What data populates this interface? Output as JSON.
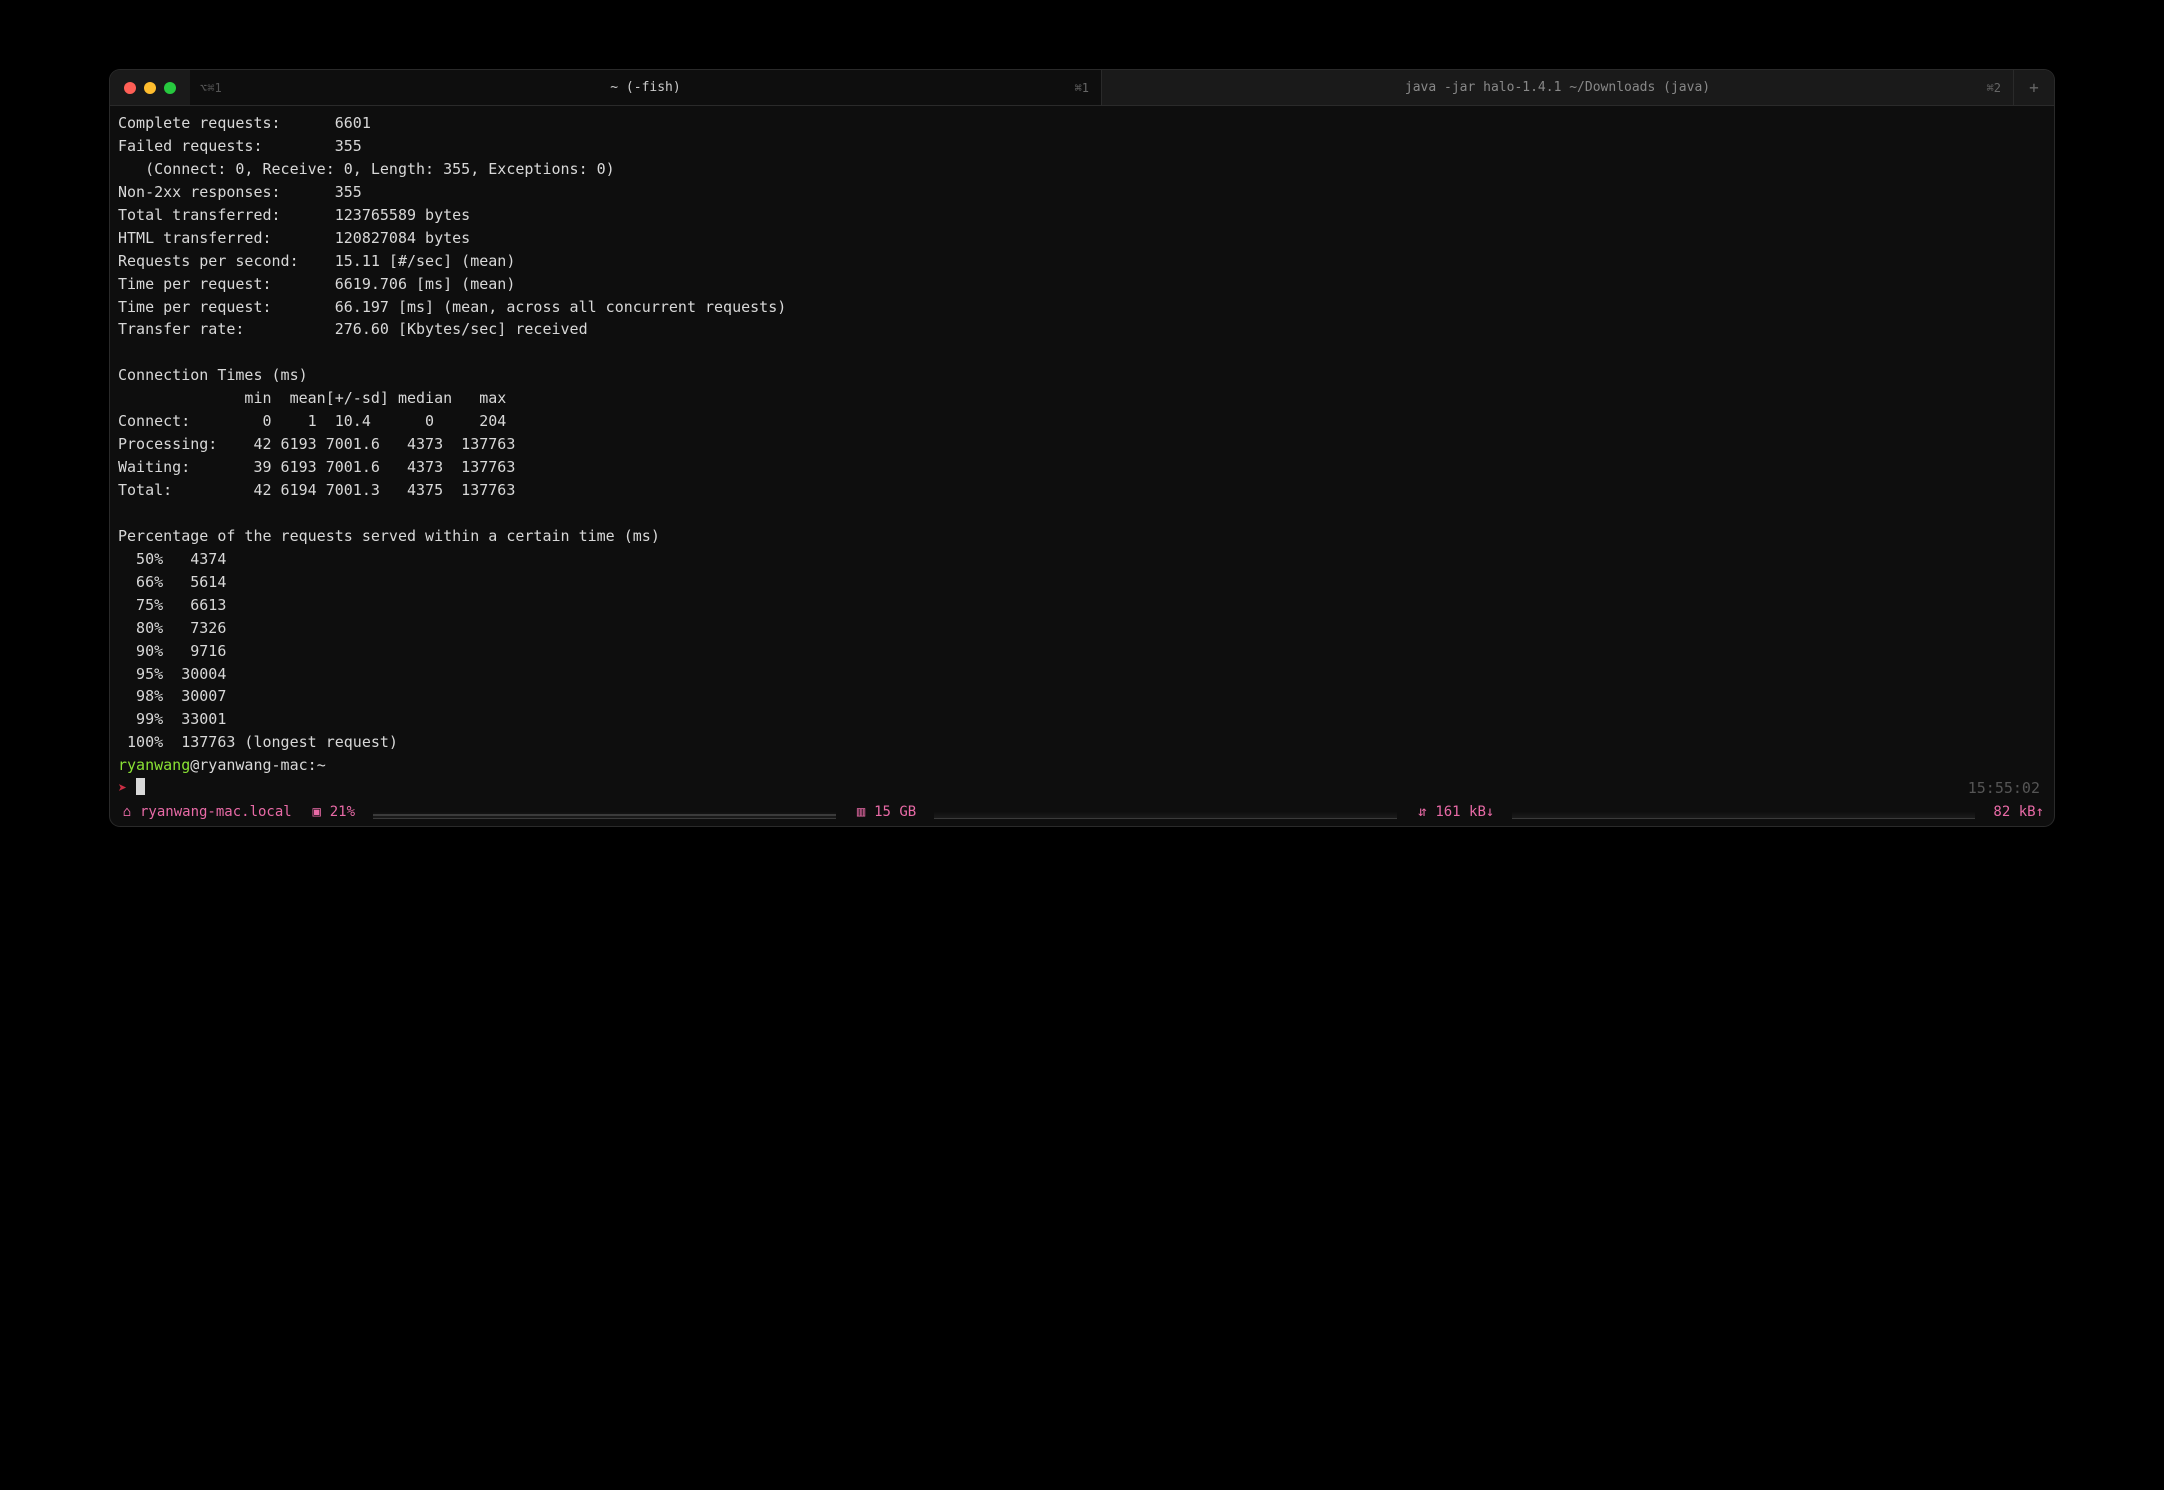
{
  "tabs": [
    {
      "title": "~ (-fish)",
      "shortcut": "⌘1",
      "leftShortcut": "⌥⌘1",
      "active": true
    },
    {
      "title": "java -jar halo-1.4.1 ~/Downloads (java)",
      "shortcut": "⌘2",
      "leftShortcut": "",
      "active": false
    }
  ],
  "output": {
    "complete_requests": "Complete requests:      6601",
    "failed_requests": "Failed requests:        355",
    "failed_detail": "   (Connect: 0, Receive: 0, Length: 355, Exceptions: 0)",
    "non2xx": "Non-2xx responses:      355",
    "total_transferred": "Total transferred:      123765589 bytes",
    "html_transferred": "HTML transferred:       120827084 bytes",
    "rps": "Requests per second:    15.11 [#/sec] (mean)",
    "tpr1": "Time per request:       6619.706 [ms] (mean)",
    "tpr2": "Time per request:       66.197 [ms] (mean, across all concurrent requests)",
    "transfer_rate": "Transfer rate:          276.60 [Kbytes/sec] received",
    "blank1": "",
    "ct_header": "Connection Times (ms)",
    "ct_cols": "              min  mean[+/-sd] median   max",
    "ct_connect": "Connect:        0    1  10.4      0     204",
    "ct_processing": "Processing:    42 6193 7001.6   4373  137763",
    "ct_waiting": "Waiting:       39 6193 7001.6   4373  137763",
    "ct_total": "Total:         42 6194 7001.3   4375  137763",
    "blank2": "",
    "pct_header": "Percentage of the requests served within a certain time (ms)",
    "pct50": "  50%   4374",
    "pct66": "  66%   5614",
    "pct75": "  75%   6613",
    "pct80": "  80%   7326",
    "pct90": "  90%   9716",
    "pct95": "  95%  30004",
    "pct98": "  98%  30007",
    "pct99": "  99%  33001",
    "pct100": " 100%  137763 (longest request)"
  },
  "prompt": {
    "user": "ryanwang",
    "at": "@",
    "host": "ryanwang-mac",
    "colon": ":",
    "path": "~",
    "arrow": "➤",
    "time": "15:55:02"
  },
  "status": {
    "host_icon": "⌂",
    "host": "ryanwang-mac.local",
    "cpu_icon": "▣",
    "cpu": "21%",
    "mem_icon": "▥",
    "mem": "15 GB",
    "net_icon": "⇵",
    "net_down": "161 kB↓",
    "net_up": "82 kB↑"
  }
}
